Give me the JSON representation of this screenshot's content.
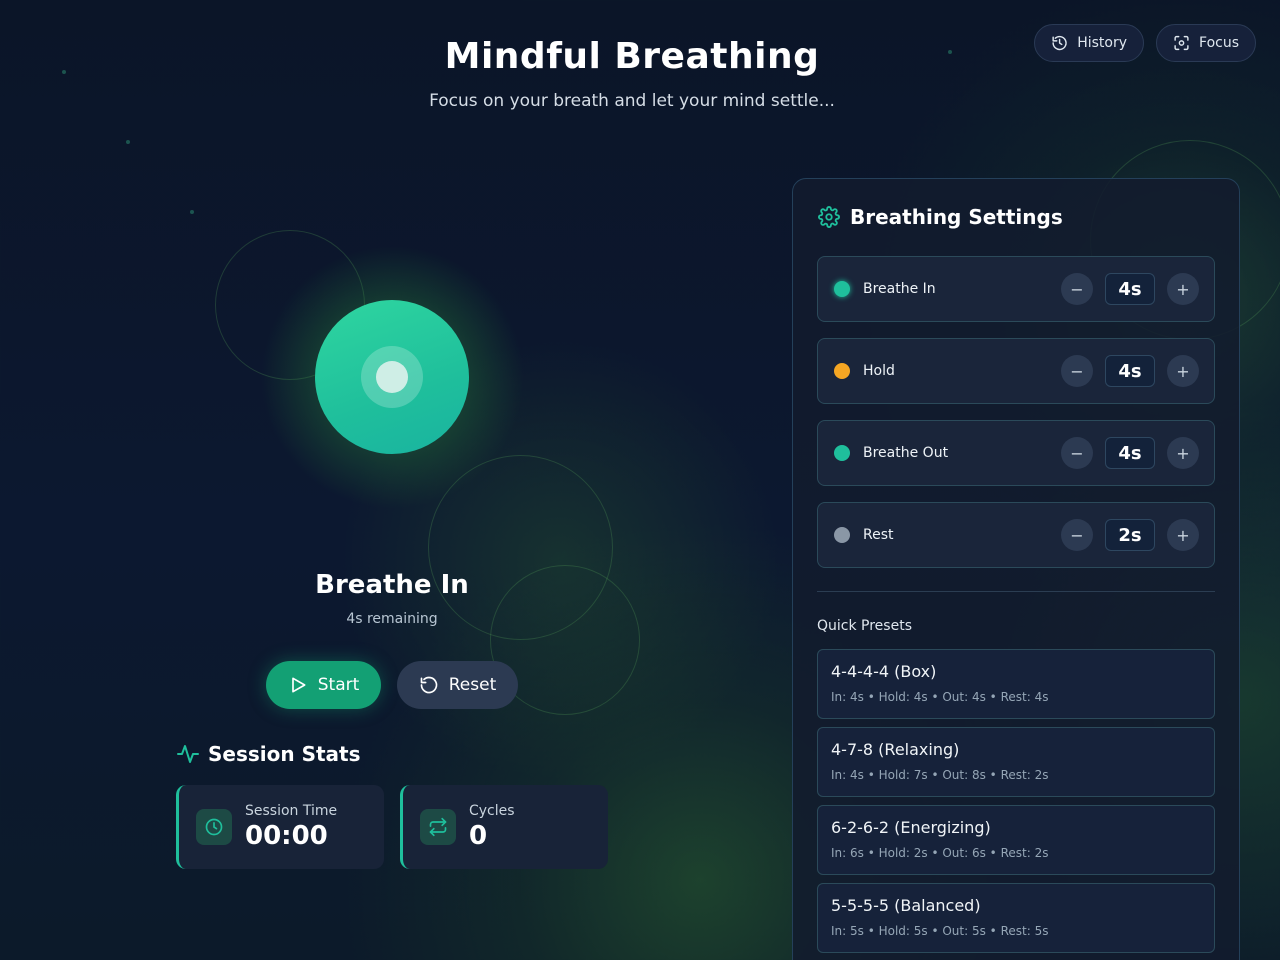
{
  "header": {
    "title": "Mindful Breathing",
    "subtitle": "Focus on your breath and let your mind settle..."
  },
  "top_buttons": {
    "history": "History",
    "focus": "Focus"
  },
  "breath": {
    "phase": "Breathe In",
    "remaining": "4s remaining"
  },
  "controls": {
    "start": "Start",
    "reset": "Reset"
  },
  "stats": {
    "title": "Session Stats",
    "session_time_label": "Session Time",
    "session_time_value": "00:00",
    "cycles_label": "Cycles",
    "cycles_value": "0"
  },
  "settings": {
    "title": "Breathing Settings",
    "items": [
      {
        "label": "Breathe In",
        "value": "4s",
        "color": "#1fbf9c"
      },
      {
        "label": "Hold",
        "value": "4s",
        "color": "#f5a623"
      },
      {
        "label": "Breathe Out",
        "value": "4s",
        "color": "#1fbf9c"
      },
      {
        "label": "Rest",
        "value": "2s",
        "color": "#8a97a6"
      }
    ],
    "presets_title": "Quick Presets",
    "presets": [
      {
        "name": "4-4-4-4 (Box)",
        "detail": "In: 4s • Hold: 4s • Out: 4s • Rest: 4s"
      },
      {
        "name": "4-7-8 (Relaxing)",
        "detail": "In: 4s • Hold: 7s • Out: 8s • Rest: 2s"
      },
      {
        "name": "6-2-6-2 (Energizing)",
        "detail": "In: 6s • Hold: 2s • Out: 6s • Rest: 2s"
      },
      {
        "name": "5-5-5-5 (Balanced)",
        "detail": "In: 5s • Hold: 5s • Out: 5s • Rest: 5s"
      }
    ]
  },
  "colors": {
    "accent": "#1fbf9c",
    "start_button": "#13a074",
    "background": "#0b1528"
  }
}
